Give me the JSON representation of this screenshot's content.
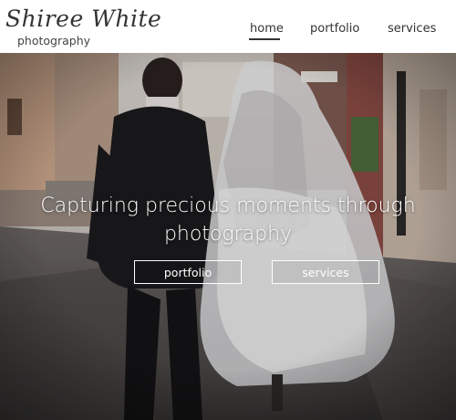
{
  "brand": {
    "script_name": "Shiree White",
    "tagline": "photography"
  },
  "nav": {
    "items": [
      {
        "label": "home",
        "active": true
      },
      {
        "label": "portfolio",
        "active": false
      },
      {
        "label": "services",
        "active": false
      }
    ]
  },
  "hero": {
    "headline_line1": "Capturing precious moments through",
    "headline_line2": "photography",
    "buttons": [
      {
        "label": "portfolio"
      },
      {
        "label": "services"
      }
    ]
  },
  "colors": {
    "text_dark": "#333333",
    "hero_text": "#ffffff"
  }
}
